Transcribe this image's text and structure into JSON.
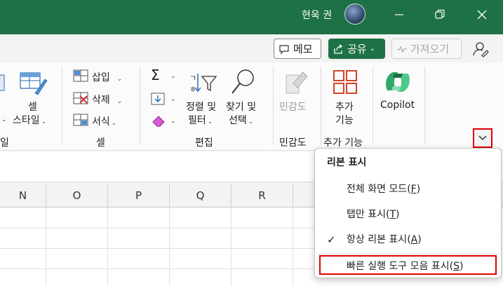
{
  "title_bar": {
    "user_name": "현욱 권"
  },
  "actions": {
    "memo_label": "메모",
    "share_label": "공유",
    "catchup_label": "가져오기"
  },
  "ribbon": {
    "style_label_top": "셀",
    "style_label_bottom": "스타일",
    "style_group_partial": "일",
    "cells": {
      "insert": "삽입",
      "delete": "삭제",
      "format": "서식",
      "group_label": "셀"
    },
    "editing": {
      "sort_top": "정렬 및",
      "sort_bottom": "필터",
      "find_top": "찾기 및",
      "find_bottom": "선택",
      "group_label": "편집"
    },
    "sensitivity": {
      "label": "민감도",
      "group_label": "민감도"
    },
    "addins": {
      "label_top": "추가",
      "label_bottom": "기능",
      "group_label": "추가 기능"
    },
    "copilot": {
      "label": "Copilot"
    }
  },
  "sheet": {
    "columns": [
      "N",
      "O",
      "P",
      "Q",
      "R"
    ]
  },
  "menu": {
    "title": "리본 표시",
    "items": [
      {
        "text": "전체 화면 모드",
        "key": "F"
      },
      {
        "text": "탭만 표시",
        "key": "T"
      },
      {
        "text": "항상 리본 표시",
        "key": "A"
      },
      {
        "text": "빠른 실행 도구 모음 표시",
        "key": "S"
      }
    ]
  },
  "colors": {
    "excel_green": "#1e7145",
    "highlight_red": "#e00000"
  }
}
